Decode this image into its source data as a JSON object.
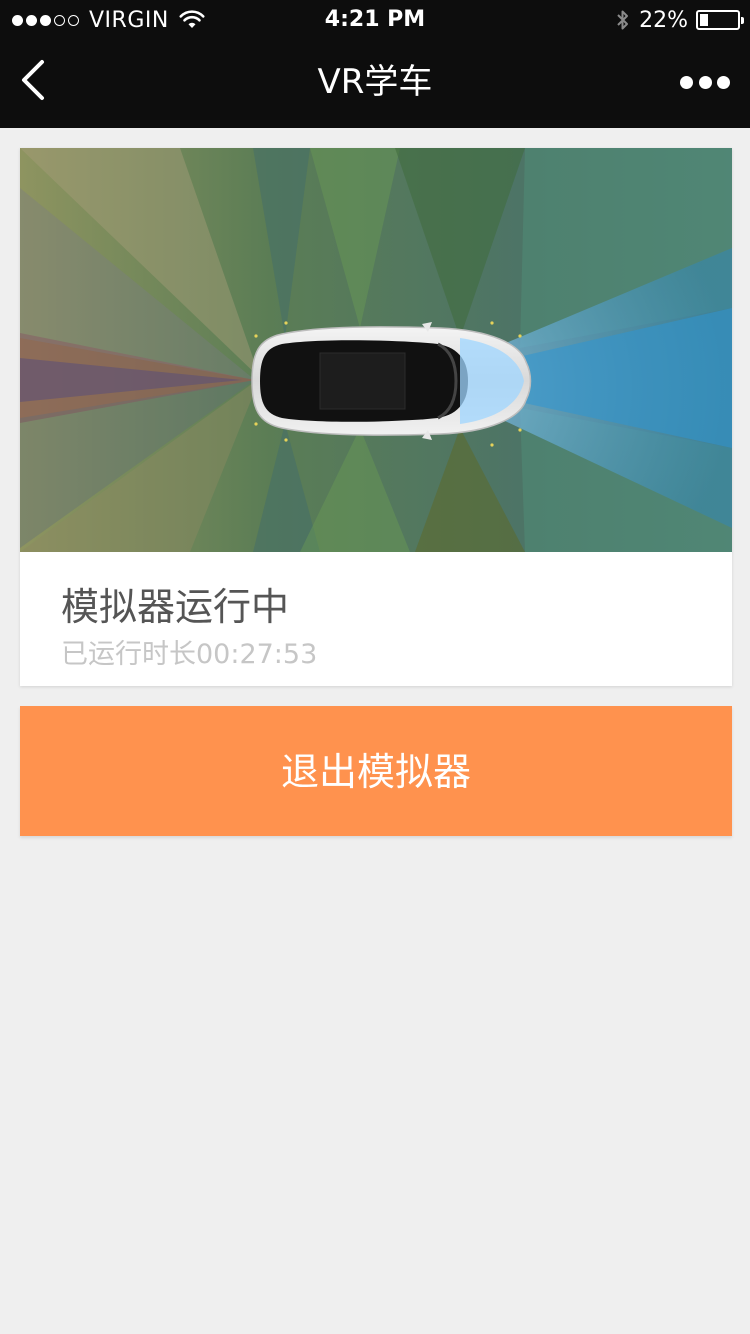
{
  "status_bar": {
    "carrier": "VIRGIN",
    "signal_filled": 3,
    "signal_total": 5,
    "time": "4:21 PM",
    "battery_percent": "22%",
    "battery_level": 0.22
  },
  "nav": {
    "title": "VR学车",
    "back_icon": "chevron-left-icon",
    "more_icon": "more-dots-icon"
  },
  "simulator": {
    "title": "模拟器运行中",
    "elapsed_label": "已运行时长00:27:53"
  },
  "actions": {
    "exit_label": "退出模拟器"
  },
  "colors": {
    "bar_background": "#0d0d0d",
    "page_background": "#efefef",
    "accent_orange": "#ff924e"
  }
}
